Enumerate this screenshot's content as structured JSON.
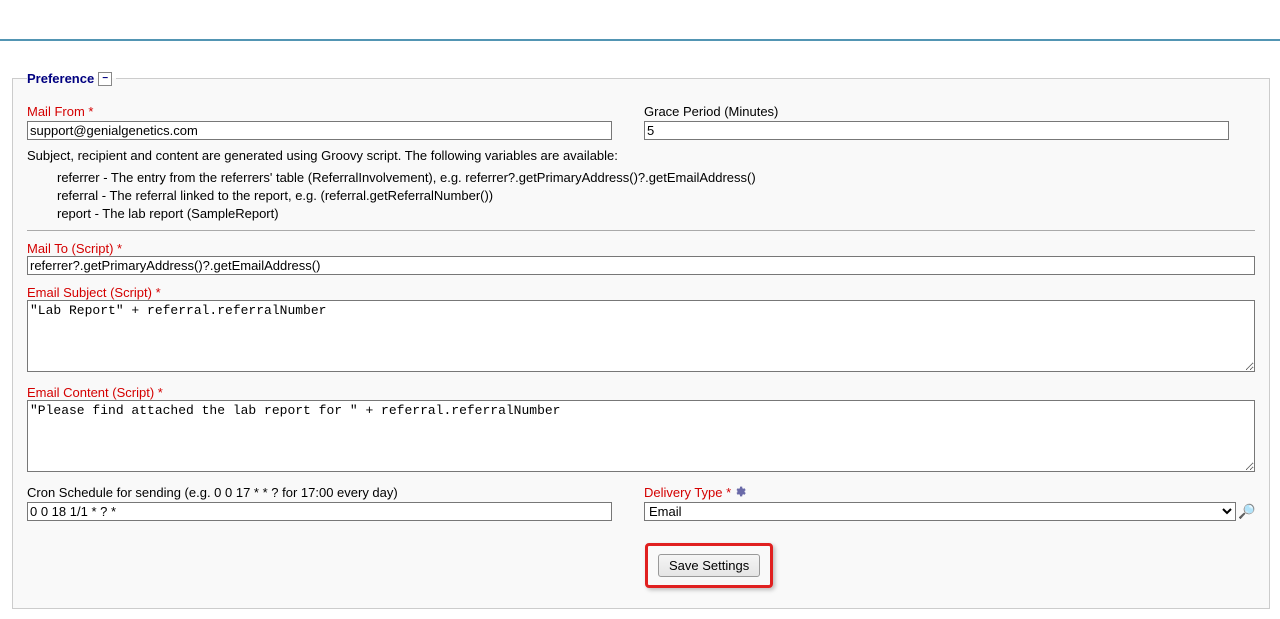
{
  "legend": {
    "title": "Preference",
    "collapse_symbol": "−"
  },
  "labels": {
    "mail_from": "Mail From *",
    "grace_period": "Grace Period (Minutes)",
    "mail_to": "Mail To (Script) *",
    "email_subject": "Email Subject (Script) *",
    "email_content": "Email Content (Script) *",
    "cron": "Cron Schedule for sending (e.g. 0 0 17 * * ? for 17:00 every day)",
    "delivery_type": "Delivery Type *"
  },
  "values": {
    "mail_from": "support@genialgenetics.com",
    "grace_period": "5",
    "mail_to": "referrer?.getPrimaryAddress()?.getEmailAddress()",
    "email_subject": "\"Lab Report\" + referral.referralNumber",
    "email_content": "\"Please find attached the lab report for \" + referral.referralNumber",
    "cron": "0 0 18 1/1 * ? *",
    "delivery_type": "Email"
  },
  "help": {
    "intro": "Subject, recipient and content are generated using Groovy script. The following variables are available:",
    "vars": [
      "referrer - The entry from the referrers' table (ReferralInvolvement), e.g. referrer?.getPrimaryAddress()?.getEmailAddress()",
      "referral - The referral linked to the report, e.g. (referral.getReferralNumber())",
      "report - The lab report (SampleReport)"
    ]
  },
  "save_button": "Save Settings"
}
